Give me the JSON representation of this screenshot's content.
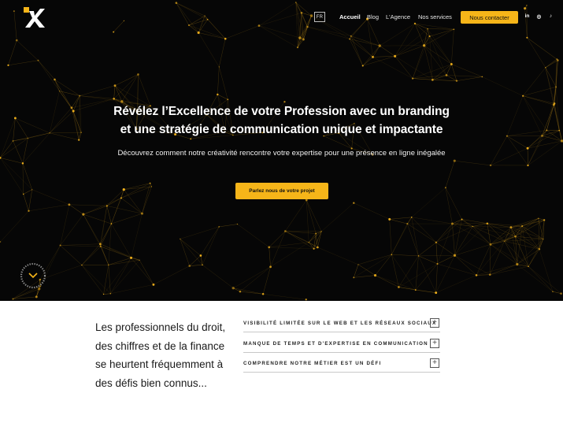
{
  "header": {
    "logo_icon": "agency-x-logo",
    "language": "FR",
    "nav": [
      {
        "label": "Accueil",
        "active": true
      },
      {
        "label": "Blog",
        "active": false
      },
      {
        "label": "L'Agence",
        "active": false
      },
      {
        "label": "Nos services",
        "active": false
      }
    ],
    "contact_label": "Nous contacter",
    "social": [
      {
        "icon": "linkedin-icon",
        "glyph": "in"
      },
      {
        "icon": "instagram-icon",
        "glyph": "◎"
      },
      {
        "icon": "tiktok-icon",
        "glyph": "♪"
      }
    ]
  },
  "hero": {
    "title_line1": "Révélez l’Excellence de votre Profession avec un branding",
    "title_line2": "et une stratégie de communication unique et impactante",
    "subtitle": "Découvrez comment notre créativité rencontre votre expertise pour une présence en ligne inégalée",
    "cta_label": "Parlez nous de votre projet",
    "scroll_icon": "chevron-down-icon"
  },
  "intro": {
    "text": "Les professionnels du droit, des chiffres et de la finance se heurtent fréquemment à des défis bien connus..."
  },
  "accordion": [
    {
      "label": "VISIBILITÉ LIMITÉE SUR LE WEB ET LES RÉSEAUX SOCIAUX",
      "toggle": "+"
    },
    {
      "label": "MANQUE DE TEMPS ET D'EXPERTISE EN COMMUNICATION",
      "toggle": "+"
    },
    {
      "label": "COMPRENDRE NOTRE MÉTIER EST UN DÉFI",
      "toggle": "+"
    }
  ],
  "colors": {
    "accent": "#f6b519",
    "hero_bg": "#060606",
    "text": "#1a1a1a"
  }
}
